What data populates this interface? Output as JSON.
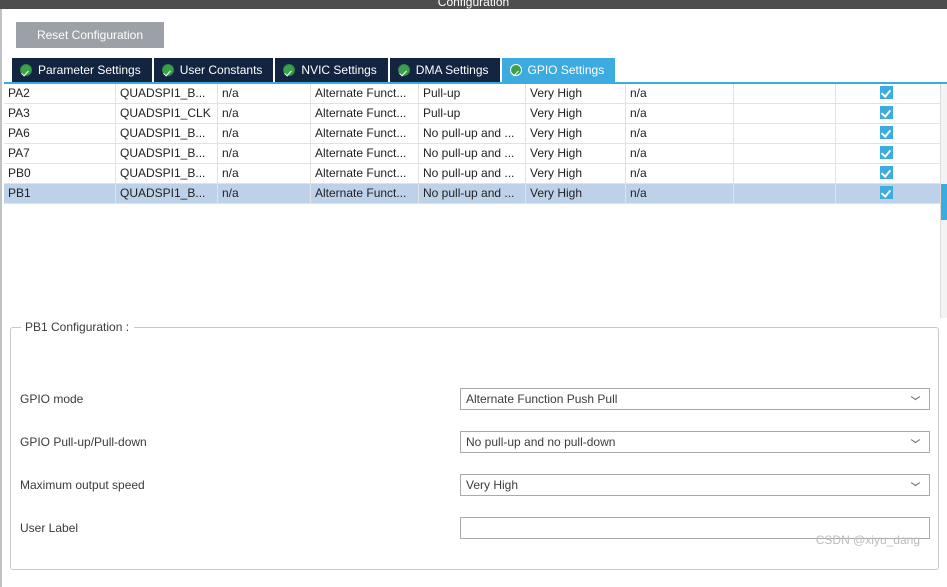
{
  "window": {
    "title": "Configuration"
  },
  "toolbar": {
    "reset_label": "Reset Configuration"
  },
  "tabs": [
    {
      "label": "Parameter Settings",
      "icon": "check-circle-icon",
      "active": false
    },
    {
      "label": "User Constants",
      "icon": "check-circle-icon",
      "active": false
    },
    {
      "label": "NVIC Settings",
      "icon": "check-circle-icon",
      "active": false
    },
    {
      "label": "DMA Settings",
      "icon": "check-circle-icon",
      "active": false
    },
    {
      "label": "GPIO Settings",
      "icon": "check-circle-icon",
      "active": true
    }
  ],
  "table": {
    "rows": [
      {
        "pin": "PA2",
        "signal": "QUADSPI1_B...",
        "gpio_output_level": "n/a",
        "gpio_mode": "Alternate Funct...",
        "gpio_pull": "Pull-up",
        "max_speed": "Very High",
        "fast_mode": "n/a",
        "user_label": "",
        "modified": true,
        "selected": false
      },
      {
        "pin": "PA3",
        "signal": "QUADSPI1_CLK",
        "gpio_output_level": "n/a",
        "gpio_mode": "Alternate Funct...",
        "gpio_pull": "Pull-up",
        "max_speed": "Very High",
        "fast_mode": "n/a",
        "user_label": "",
        "modified": true,
        "selected": false
      },
      {
        "pin": "PA6",
        "signal": "QUADSPI1_B...",
        "gpio_output_level": "n/a",
        "gpio_mode": "Alternate Funct...",
        "gpio_pull": "No pull-up and ...",
        "max_speed": "Very High",
        "fast_mode": "n/a",
        "user_label": "",
        "modified": true,
        "selected": false
      },
      {
        "pin": "PA7",
        "signal": "QUADSPI1_B...",
        "gpio_output_level": "n/a",
        "gpio_mode": "Alternate Funct...",
        "gpio_pull": "No pull-up and ...",
        "max_speed": "Very High",
        "fast_mode": "n/a",
        "user_label": "",
        "modified": true,
        "selected": false
      },
      {
        "pin": "PB0",
        "signal": "QUADSPI1_B...",
        "gpio_output_level": "n/a",
        "gpio_mode": "Alternate Funct...",
        "gpio_pull": "No pull-up and ...",
        "max_speed": "Very High",
        "fast_mode": "n/a",
        "user_label": "",
        "modified": true,
        "selected": false
      },
      {
        "pin": "PB1",
        "signal": "QUADSPI1_B...",
        "gpio_output_level": "n/a",
        "gpio_mode": "Alternate Funct...",
        "gpio_pull": "No pull-up and ...",
        "max_speed": "Very High",
        "fast_mode": "n/a",
        "user_label": "",
        "modified": true,
        "selected": true
      }
    ]
  },
  "config_panel": {
    "legend": "PB1 Configuration :",
    "fields": [
      {
        "label": "GPIO mode",
        "value": "Alternate Function Push Pull",
        "control": "dropdown"
      },
      {
        "label": "GPIO Pull-up/Pull-down",
        "value": "No pull-up and no pull-down",
        "control": "dropdown"
      },
      {
        "label": "Maximum output speed",
        "value": "Very High",
        "control": "dropdown"
      },
      {
        "label": "User Label",
        "value": "",
        "control": "textbox"
      }
    ]
  },
  "watermark": {
    "text": "CSDN @xiyu_dang"
  },
  "colors": {
    "tab_inactive_bg": "#12243f",
    "tab_active_bg": "#3cabe0",
    "accent": "#3cabe0",
    "selection": "#bdd1e8",
    "button_bg": "#9ba1a6",
    "titlebar_bg": "#4d4d4d",
    "check_icon": "#3aa14a"
  }
}
